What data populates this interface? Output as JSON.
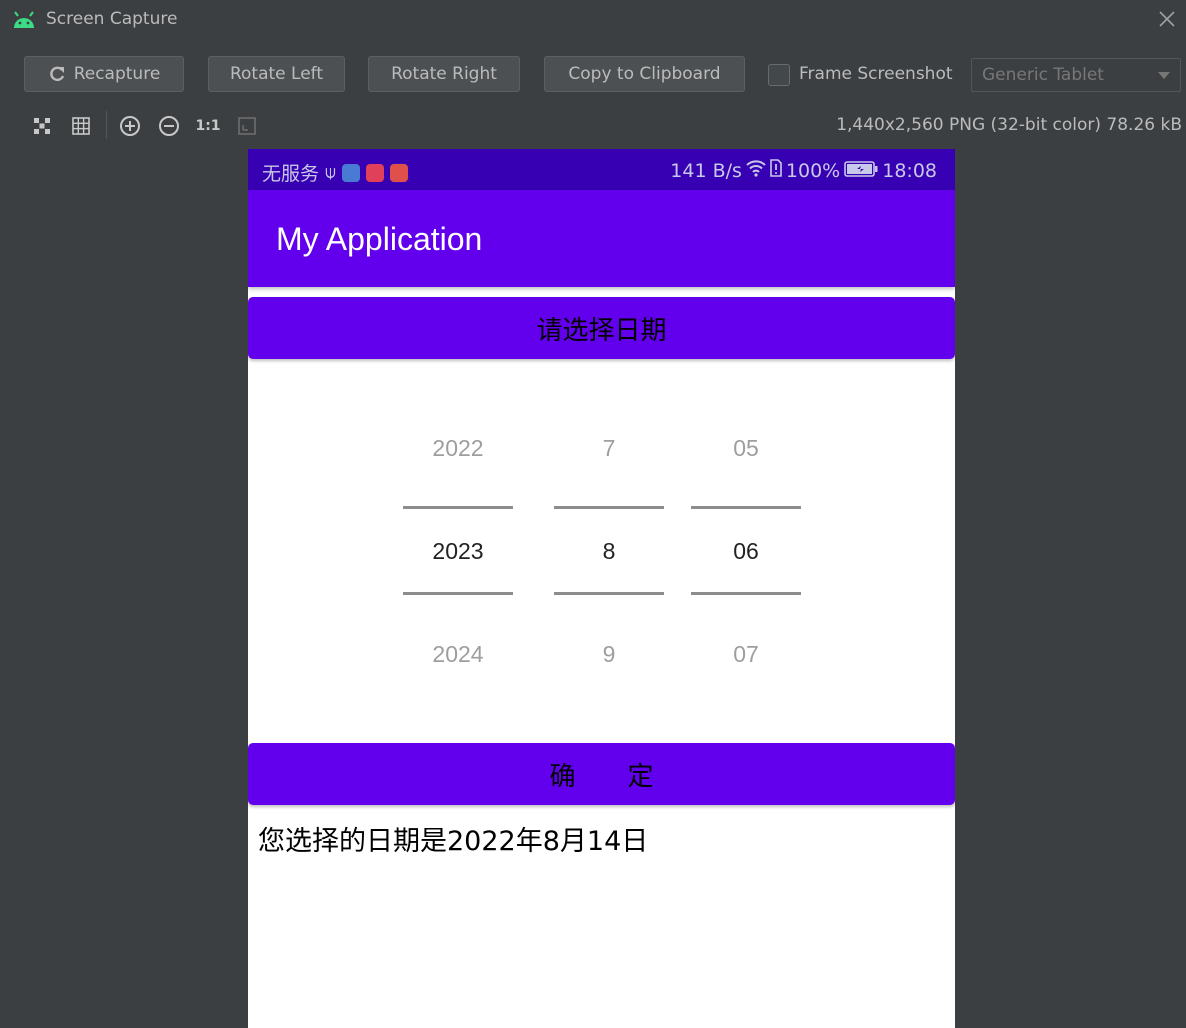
{
  "window": {
    "title": "Screen Capture"
  },
  "toolbar": {
    "recapture_label": "Recapture",
    "rotate_left_label": "Rotate Left",
    "rotate_right_label": "Rotate Right",
    "copy_label": "Copy to Clipboard",
    "frame_label": "Frame Screenshot",
    "frame_checked": false,
    "device_select": "Generic Tablet"
  },
  "viewbar": {
    "zoom_1to1_label": "1:1",
    "image_info": "1,440x2,560 PNG (32-bit color) 78.26 kB"
  },
  "phone": {
    "status": {
      "carrier": "无服务",
      "speed": "141 B/s",
      "battery": "100%",
      "time": "18:08"
    },
    "app_title": "My Application",
    "prompt_button": "请选择日期",
    "picker": {
      "year": [
        "2022",
        "2023",
        "2024"
      ],
      "month": [
        "7",
        "8",
        "9"
      ],
      "day": [
        "05",
        "06",
        "07"
      ]
    },
    "confirm_button": "确　　定",
    "result_text": "您选择的日期是2022年8月14日"
  },
  "colors": {
    "primary": "#6200ee",
    "primary_dark": "#3700b3",
    "ide_background": "#3c3f41"
  }
}
